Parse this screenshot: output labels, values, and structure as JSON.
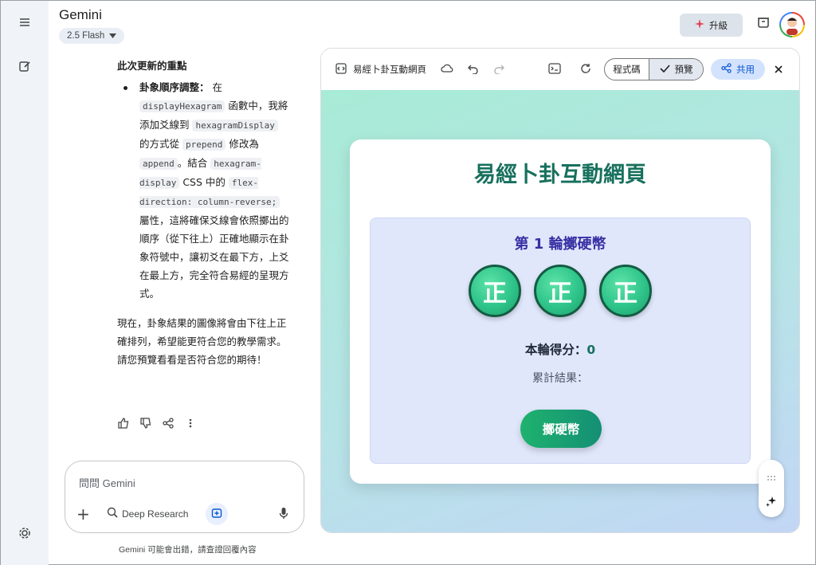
{
  "app": {
    "title": "Gemini",
    "model": "2.5 Flash"
  },
  "header": {
    "upgrade_label": "升級"
  },
  "chat": {
    "heading": "此次更新的重點",
    "bullet": {
      "lead": "卦象順序調整：",
      "t1": " 在 ",
      "c1": "displayHexagram",
      "t2": " 函數中，我將添加爻線到 ",
      "c2": "hexagramDisplay",
      "t3": " 的方式從 ",
      "c3": "prepend",
      "t4": " 修改為 ",
      "c4": "append",
      "t5": "。結合 ",
      "c5": "hexagram-display",
      "t6": " CSS 中的 ",
      "c6": "flex-direction: column-reverse;",
      "t7": " 屬性，這將確保爻線會依照擲出的順序（從下往上）正確地顯示在卦象符號中，讓初爻在最下方，上爻在最上方，完全符合易經的呈現方式。"
    },
    "closing": "現在，卦象結果的圖像將會由下往上正確排列，希望能更符合您的教學需求。請您預覽看看是否符合您的期待！"
  },
  "composer": {
    "placeholder": "問問 Gemini",
    "deep_research": "Deep Research"
  },
  "disclaimer": "Gemini 可能會出錯，請查證回覆內容",
  "canvas": {
    "title": "易經卜卦互動網頁",
    "code_tab": "程式碼",
    "preview_tab": "預覽",
    "share_label": "共用"
  },
  "app_preview": {
    "title": "易經卜卦互動網頁",
    "round_title": "第 1 輪擲硬幣",
    "coins": [
      "正",
      "正",
      "正"
    ],
    "score_label": "本輪得分：",
    "score_value": "0",
    "cumulative_label": "累計結果：",
    "toss_button": "擲硬幣"
  },
  "colors": {
    "accent_green": "#17705d",
    "round_title": "#3730a3",
    "share_blue": "#0b57d0"
  }
}
